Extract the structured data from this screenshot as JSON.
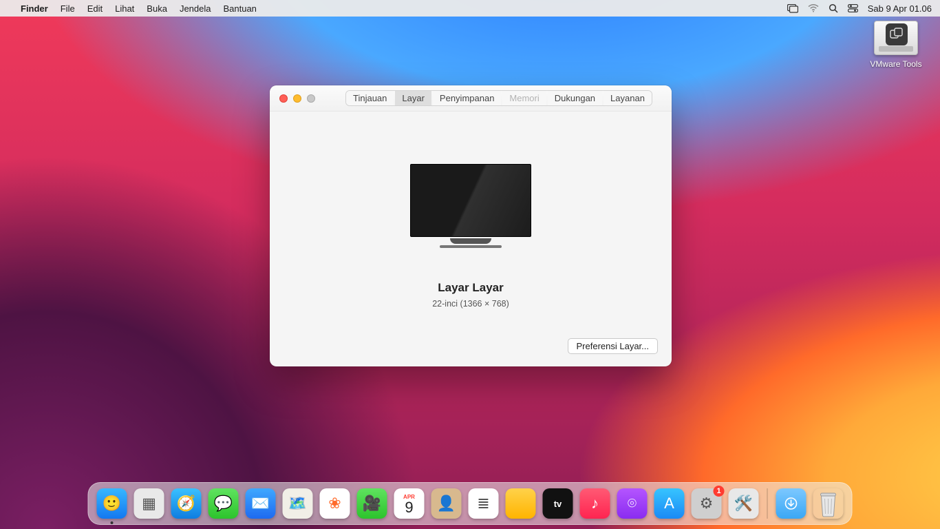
{
  "menubar": {
    "app_name": "Finder",
    "items": [
      "File",
      "Edit",
      "Lihat",
      "Buka",
      "Jendela",
      "Bantuan"
    ],
    "clock": "Sab 9 Apr  01.06"
  },
  "desktop": {
    "vmware_label": "VMware Tools"
  },
  "window": {
    "tabs": {
      "overview": "Tinjauan",
      "display": "Layar",
      "storage": "Penyimpanan",
      "memory": "Memori",
      "support": "Dukungan",
      "service": "Layanan"
    },
    "active_tab": "display",
    "display_title": "Layar Layar",
    "display_sub": "22-inci (1366 × 768)",
    "pref_button": "Preferensi Layar..."
  },
  "dock": {
    "apps": [
      {
        "name": "finder",
        "bg": "linear-gradient(#38b7ff,#1378f0)",
        "glyph": "🙂",
        "running": true
      },
      {
        "name": "launchpad",
        "bg": "#e9e9e9",
        "glyph": "▦",
        "color": "#555"
      },
      {
        "name": "safari",
        "bg": "linear-gradient(#39c1ff,#0f7de0)",
        "glyph": "🧭"
      },
      {
        "name": "messages",
        "bg": "linear-gradient(#5fe35f,#2cc32c)",
        "glyph": "💬"
      },
      {
        "name": "mail",
        "bg": "linear-gradient(#3ea8ff,#1e6af0)",
        "glyph": "✉️"
      },
      {
        "name": "maps",
        "bg": "#f1efe7",
        "glyph": "🗺️"
      },
      {
        "name": "photos",
        "bg": "#ffffff",
        "glyph": "❀",
        "color": "#ff6a2a"
      },
      {
        "name": "facetime",
        "bg": "linear-gradient(#5fe35f,#2cc32c)",
        "glyph": "🎥"
      },
      {
        "name": "calendar",
        "bg": "#ffffff",
        "glyph": "9",
        "color": "#222",
        "header": "APR"
      },
      {
        "name": "contacts",
        "bg": "#d8b98e",
        "glyph": "👤"
      },
      {
        "name": "reminders",
        "bg": "#ffffff",
        "glyph": "≣",
        "color": "#555"
      },
      {
        "name": "notes",
        "bg": "linear-gradient(#ffd24a,#ffb400)",
        "glyph": ""
      },
      {
        "name": "tv",
        "bg": "#111111",
        "glyph": "tv",
        "text": true
      },
      {
        "name": "music",
        "bg": "linear-gradient(#ff5a74,#ff2450)",
        "glyph": "♪"
      },
      {
        "name": "podcasts",
        "bg": "linear-gradient(#b455ff,#8a2cf0)",
        "glyph": "⌾"
      },
      {
        "name": "appstore",
        "bg": "linear-gradient(#37c4ff,#1a8af5)",
        "glyph": "A"
      },
      {
        "name": "settings",
        "bg": "#cfcfcf",
        "glyph": "⚙︎",
        "color": "#555",
        "badge": "1"
      },
      {
        "name": "utility",
        "bg": "#e8e8e8",
        "glyph": "🛠️"
      }
    ],
    "downloads_name": "downloads",
    "trash_name": "trash"
  }
}
